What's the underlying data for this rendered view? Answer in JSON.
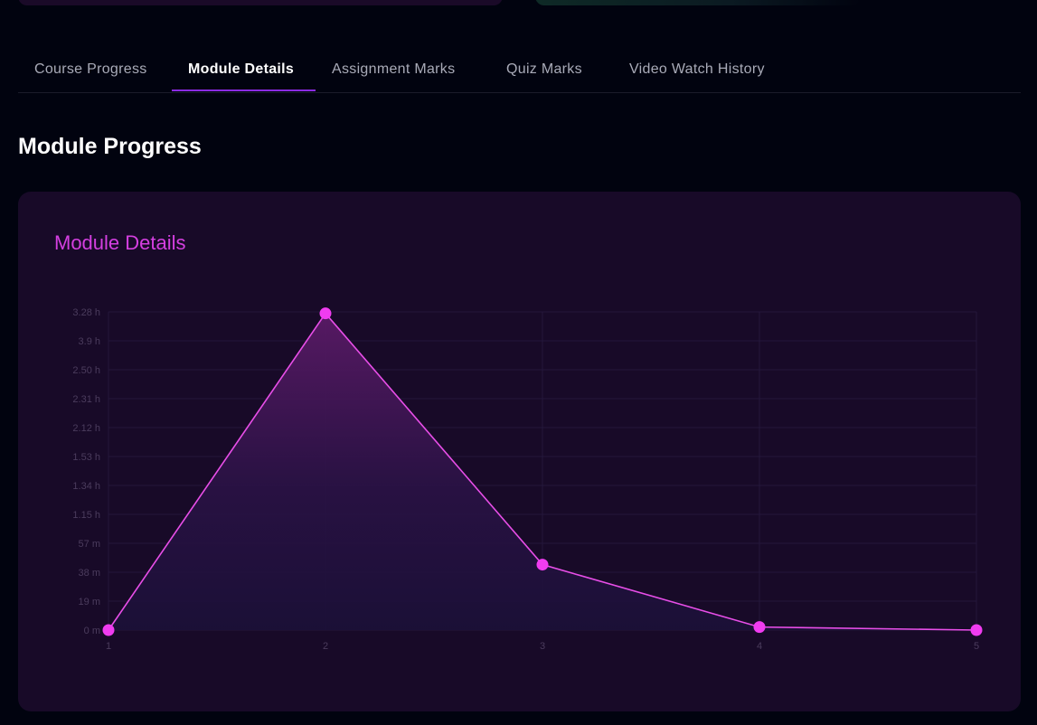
{
  "tabs": [
    {
      "label": "Course Progress",
      "active": false
    },
    {
      "label": "Module Details",
      "active": true
    },
    {
      "label": "Assignment Marks",
      "active": false
    },
    {
      "label": "Quiz Marks",
      "active": false
    },
    {
      "label": "Video Watch History",
      "active": false
    }
  ],
  "section": {
    "title": "Module Progress"
  },
  "chart_card": {
    "title": "Module Details"
  },
  "colors": {
    "accent": "#d43fe0",
    "line": "#e84ee8",
    "tab_underline": "#8a2be2"
  },
  "chart_data": {
    "type": "area",
    "title": "Module Details",
    "x": [
      "1",
      "2",
      "3",
      "4",
      "5"
    ],
    "y_tick_labels": [
      "0 m",
      "19 m",
      "38 m",
      "57 m",
      "1.15 h",
      "1.34 h",
      "1.53 h",
      "2.12 h",
      "2.31 h",
      "2.50 h",
      "3.9 h",
      "3.28 h"
    ],
    "y_minutes": [
      0,
      208,
      43,
      2,
      0
    ],
    "ylim_minutes": [
      0,
      209
    ],
    "grid": true,
    "legend": "none"
  }
}
